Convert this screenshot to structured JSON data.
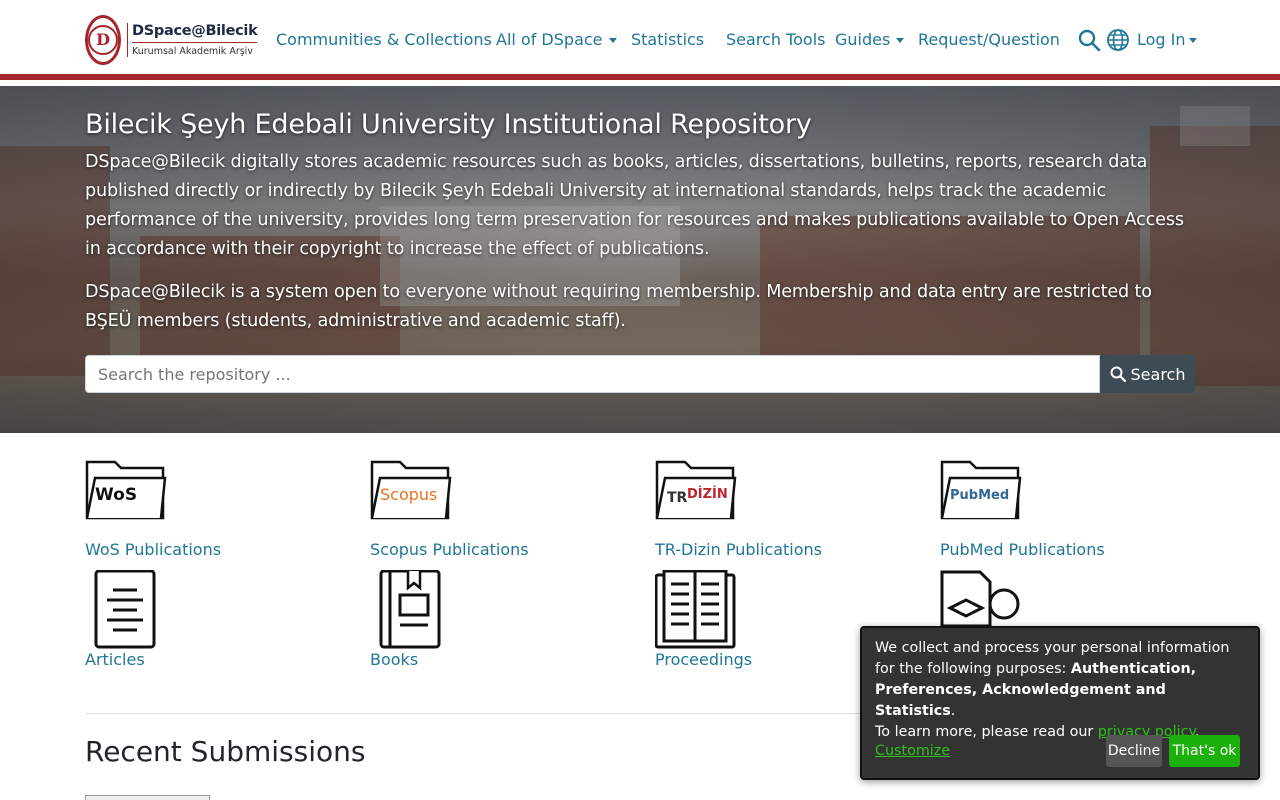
{
  "header": {
    "logo_title": "DSpace@Bilecik",
    "logo_subtitle": "Kurumsal Akademik Arşiv",
    "nav": {
      "communities": "Communities & Collections",
      "all_dspace": "All of DSpace",
      "statistics": "Statistics",
      "search_tools": "Search Tools",
      "guides": "Guides",
      "request": "Request/Question",
      "login": "Log In"
    },
    "accent_color": "#a6262c",
    "link_color": "#207698"
  },
  "hero": {
    "title": "Bilecik Şeyh Edebali University Institutional Repository",
    "paragraph1": "DSpace@Bilecik digitally stores academic resources such as books, articles, dissertations, bulletins, reports, research data published directly or indirectly by Bilecik Şeyh Edebali University at international standards, helps track the academic performance of the university, provides long term preservation for resources and makes publications available to Open Access in accordance with their copyright to increase the effect of publications.",
    "paragraph2": "DSpace@Bilecik is a system open to everyone without requiring membership. Membership and data entry are restricted to BŞEÜ members (students, administrative and academic staff).",
    "search_placeholder": "Search the repository ...",
    "search_button": "Search"
  },
  "tiles": {
    "wos": {
      "label": "WoS Publications",
      "logo_text": "WoS"
    },
    "scopus": {
      "label": "Scopus Publications",
      "logo_text": "Scopus"
    },
    "trdizin": {
      "label": "TR-Dizin Publications",
      "logo_text": "DİZİN"
    },
    "pubmed": {
      "label": "PubMed Publications",
      "logo_text": "PubMed"
    },
    "articles": {
      "label": "Articles"
    },
    "books": {
      "label": "Books"
    },
    "proceedings": {
      "label": "Proceedings"
    }
  },
  "recent": {
    "title": "Recent Submissions"
  },
  "cookie": {
    "line1": "We collect and process your personal information for the following purposes: ",
    "purposes": "Authentication, Preferences, Acknowledgement and Statistics",
    "period": ".",
    "learn": "To learn more, please read our ",
    "policy_link": "privacy policy",
    "customize": "Customize",
    "decline": "Decline",
    "ok": "That's ok"
  }
}
